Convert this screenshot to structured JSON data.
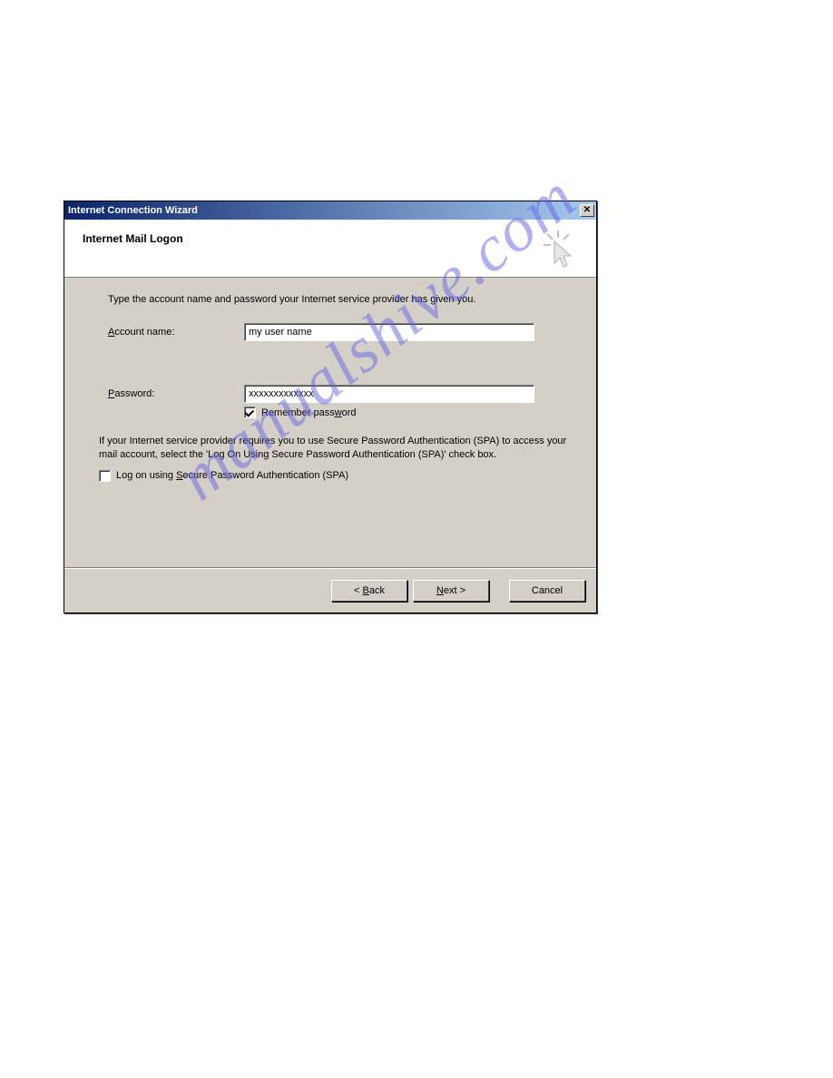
{
  "window": {
    "title": "Internet Connection Wizard"
  },
  "header": {
    "title": "Internet Mail Logon"
  },
  "body": {
    "instruction": "Type the account name and password your Internet service provider has given you.",
    "account_label_pre": "A",
    "account_label_post": "ccount name:",
    "account_value": "my user name",
    "password_label_pre": "P",
    "password_label_post": "assword:",
    "password_value": "xxxxxxxxxxxxx",
    "remember_pre": "Remember pass",
    "remember_u": "w",
    "remember_post": "ord",
    "remember_checked": true,
    "spa_text": "If your Internet service provider requires you to use Secure Password Authentication (SPA) to access your mail account, select the 'Log On Using Secure Password Authentication (SPA)' check box.",
    "spa_label_pre": "Log on using ",
    "spa_label_u": "S",
    "spa_label_post": "ecure Password Authentication (SPA)",
    "spa_checked": false
  },
  "footer": {
    "back_pre": "< ",
    "back_u": "B",
    "back_post": "ack",
    "next_u": "N",
    "next_post": "ext >",
    "cancel": "Cancel"
  },
  "watermark": "manualshive.com"
}
